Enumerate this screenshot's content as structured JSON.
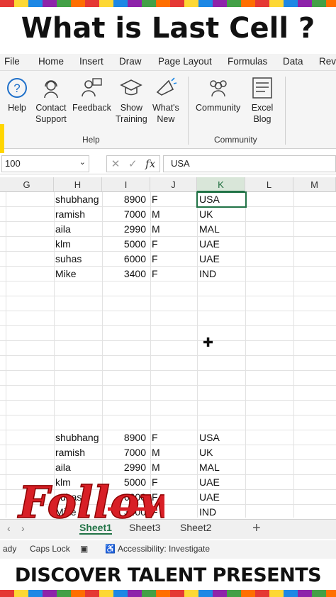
{
  "header": {
    "title": "What is Last Cell ?"
  },
  "menu": {
    "items": [
      "File",
      "Home",
      "Insert",
      "Draw",
      "Page Layout",
      "Formulas",
      "Data",
      "Revi"
    ]
  },
  "ribbon": {
    "help_group": {
      "label": "Help",
      "buttons": [
        {
          "label": "Help",
          "icon": "help-icon"
        },
        {
          "label": "Contact\nSupport",
          "icon": "headset-icon"
        },
        {
          "label": "Feedback",
          "icon": "feedback-icon"
        },
        {
          "label": "Show\nTraining",
          "icon": "mortarboard-icon"
        },
        {
          "label": "What's\nNew",
          "icon": "megaphone-icon"
        }
      ]
    },
    "community_group": {
      "label": "Community",
      "buttons": [
        {
          "label": "Community",
          "icon": "people-icon"
        },
        {
          "label": "Excel\nBlog",
          "icon": "blog-icon"
        }
      ]
    }
  },
  "formula_bar": {
    "name_box": "100",
    "fx_symbol": "fx",
    "cancel": "✕",
    "enter": "✓",
    "value": "USA"
  },
  "sheet": {
    "columns": [
      "G",
      "H",
      "I",
      "J",
      "K",
      "L",
      "M"
    ],
    "selected_column": "K",
    "block1": [
      {
        "name": "shubhang",
        "num": "8900",
        "gender": "F",
        "country": "USA"
      },
      {
        "name": "ramish",
        "num": "7000",
        "gender": "M",
        "country": "UK"
      },
      {
        "name": "aila",
        "num": "2990",
        "gender": "M",
        "country": "MAL"
      },
      {
        "name": "klm",
        "num": "5000",
        "gender": "F",
        "country": "UAE"
      },
      {
        "name": "suhas",
        "num": "6000",
        "gender": "F",
        "country": "UAE"
      },
      {
        "name": "Mike",
        "num": "3400",
        "gender": "F",
        "country": "IND"
      }
    ],
    "block2": [
      {
        "name": "shubhang",
        "num": "8900",
        "gender": "F",
        "country": "USA"
      },
      {
        "name": "ramish",
        "num": "7000",
        "gender": "M",
        "country": "UK"
      },
      {
        "name": "aila",
        "num": "2990",
        "gender": "M",
        "country": "MAL"
      },
      {
        "name": "klm",
        "num": "5000",
        "gender": "F",
        "country": "UAE"
      },
      {
        "name": "suhas",
        "num": "6000",
        "gender": "F",
        "country": "UAE"
      },
      {
        "name": "Mike",
        "num": "3400",
        "gender": "F",
        "country": "IND"
      }
    ]
  },
  "sheet_tabs": {
    "tabs": [
      "Sheet1",
      "Sheet3",
      "Sheet2"
    ],
    "active": "Sheet1",
    "add": "+",
    "prev": "‹",
    "next": "›"
  },
  "status_bar": {
    "ready": "ady",
    "caps": "Caps Lock",
    "accessibility": "Accessibility: Investigate"
  },
  "overlay": {
    "follow_text": "Follow",
    "banner": "DISCOVER TALENT PRESENTS"
  },
  "colors": {
    "accent": "#217346",
    "follow_red": "#d81f26"
  }
}
